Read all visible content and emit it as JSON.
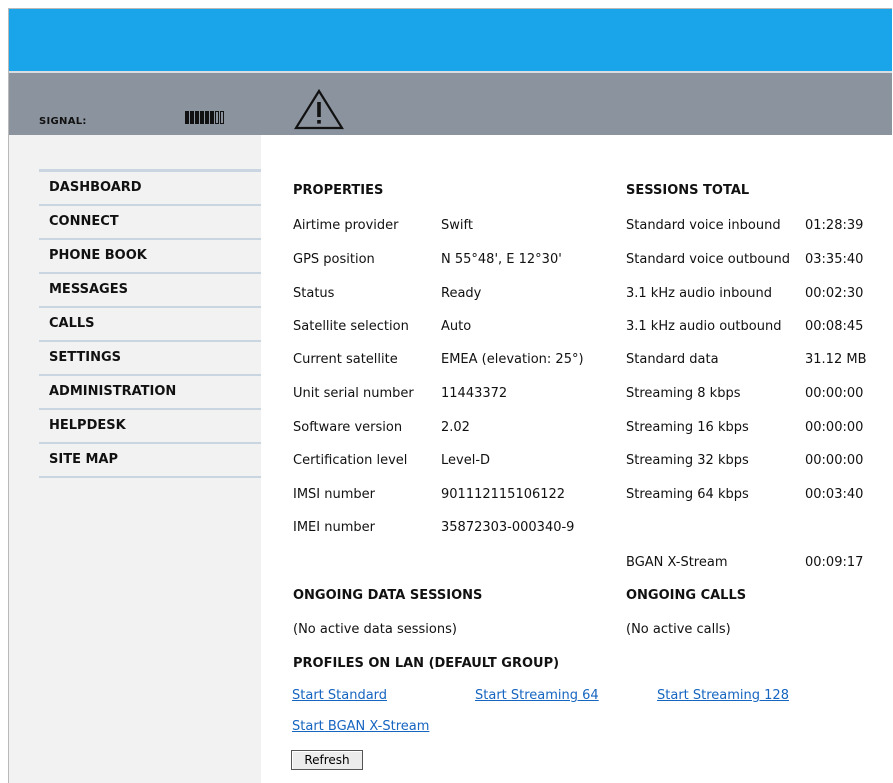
{
  "header": {
    "signal_label": "SIGNAL:",
    "signal_level": 6,
    "signal_max": 8
  },
  "sidebar": {
    "items": [
      {
        "label": "DASHBOARD"
      },
      {
        "label": "CONNECT"
      },
      {
        "label": "PHONE BOOK"
      },
      {
        "label": "MESSAGES"
      },
      {
        "label": "CALLS"
      },
      {
        "label": "SETTINGS"
      },
      {
        "label": "ADMINISTRATION"
      },
      {
        "label": "HELPDESK"
      },
      {
        "label": "SITE MAP"
      }
    ]
  },
  "properties": {
    "heading": "PROPERTIES",
    "rows": [
      {
        "label": "Airtime provider",
        "value": "Swift"
      },
      {
        "label": "GPS position",
        "value": "N 55°48', E 12°30'"
      },
      {
        "label": "Status",
        "value": "Ready"
      },
      {
        "label": "Satellite selection",
        "value": "Auto"
      },
      {
        "label": "Current satellite",
        "value": "EMEA (elevation: 25°)"
      },
      {
        "label": "Unit serial number",
        "value": "11443372"
      },
      {
        "label": "Software version",
        "value": "2.02"
      },
      {
        "label": "Certification level",
        "value": "Level-D"
      },
      {
        "label": "IMSI number",
        "value": "901112115106122"
      },
      {
        "label": "IMEI number",
        "value": "35872303-000340-9"
      }
    ]
  },
  "sessions": {
    "heading": "SESSIONS TOTAL",
    "rows": [
      {
        "label": "Standard voice inbound",
        "value": "01:28:39"
      },
      {
        "label": "Standard voice outbound",
        "value": "03:35:40"
      },
      {
        "label": "3.1 kHz audio inbound",
        "value": "00:02:30"
      },
      {
        "label": "3.1 kHz audio outbound",
        "value": "00:08:45"
      },
      {
        "label": "Standard data",
        "value": "31.12 MB"
      },
      {
        "label": "Streaming 8 kbps",
        "value": "00:00:00"
      },
      {
        "label": "Streaming 16 kbps",
        "value": "00:00:00"
      },
      {
        "label": "Streaming 32 kbps",
        "value": "00:00:00"
      },
      {
        "label": "Streaming 64 kbps",
        "value": "00:03:40"
      },
      {
        "label": "BGAN X-Stream",
        "value": "00:09:17"
      }
    ]
  },
  "ongoing_data": {
    "heading": "ONGOING DATA SESSIONS",
    "text": "(No active data sessions)"
  },
  "ongoing_calls": {
    "heading": "ONGOING CALLS",
    "text": "(No active calls)"
  },
  "profiles": {
    "heading": "PROFILES ON LAN (DEFAULT GROUP)",
    "links": [
      "Start Standard",
      "Start Streaming 64",
      "Start Streaming 128",
      "Start BGAN X-Stream"
    ]
  },
  "refresh_label": "Refresh",
  "colors": {
    "top_bar": "#1aa5ea",
    "status_bar": "#8b939e",
    "link": "#1665c0"
  }
}
